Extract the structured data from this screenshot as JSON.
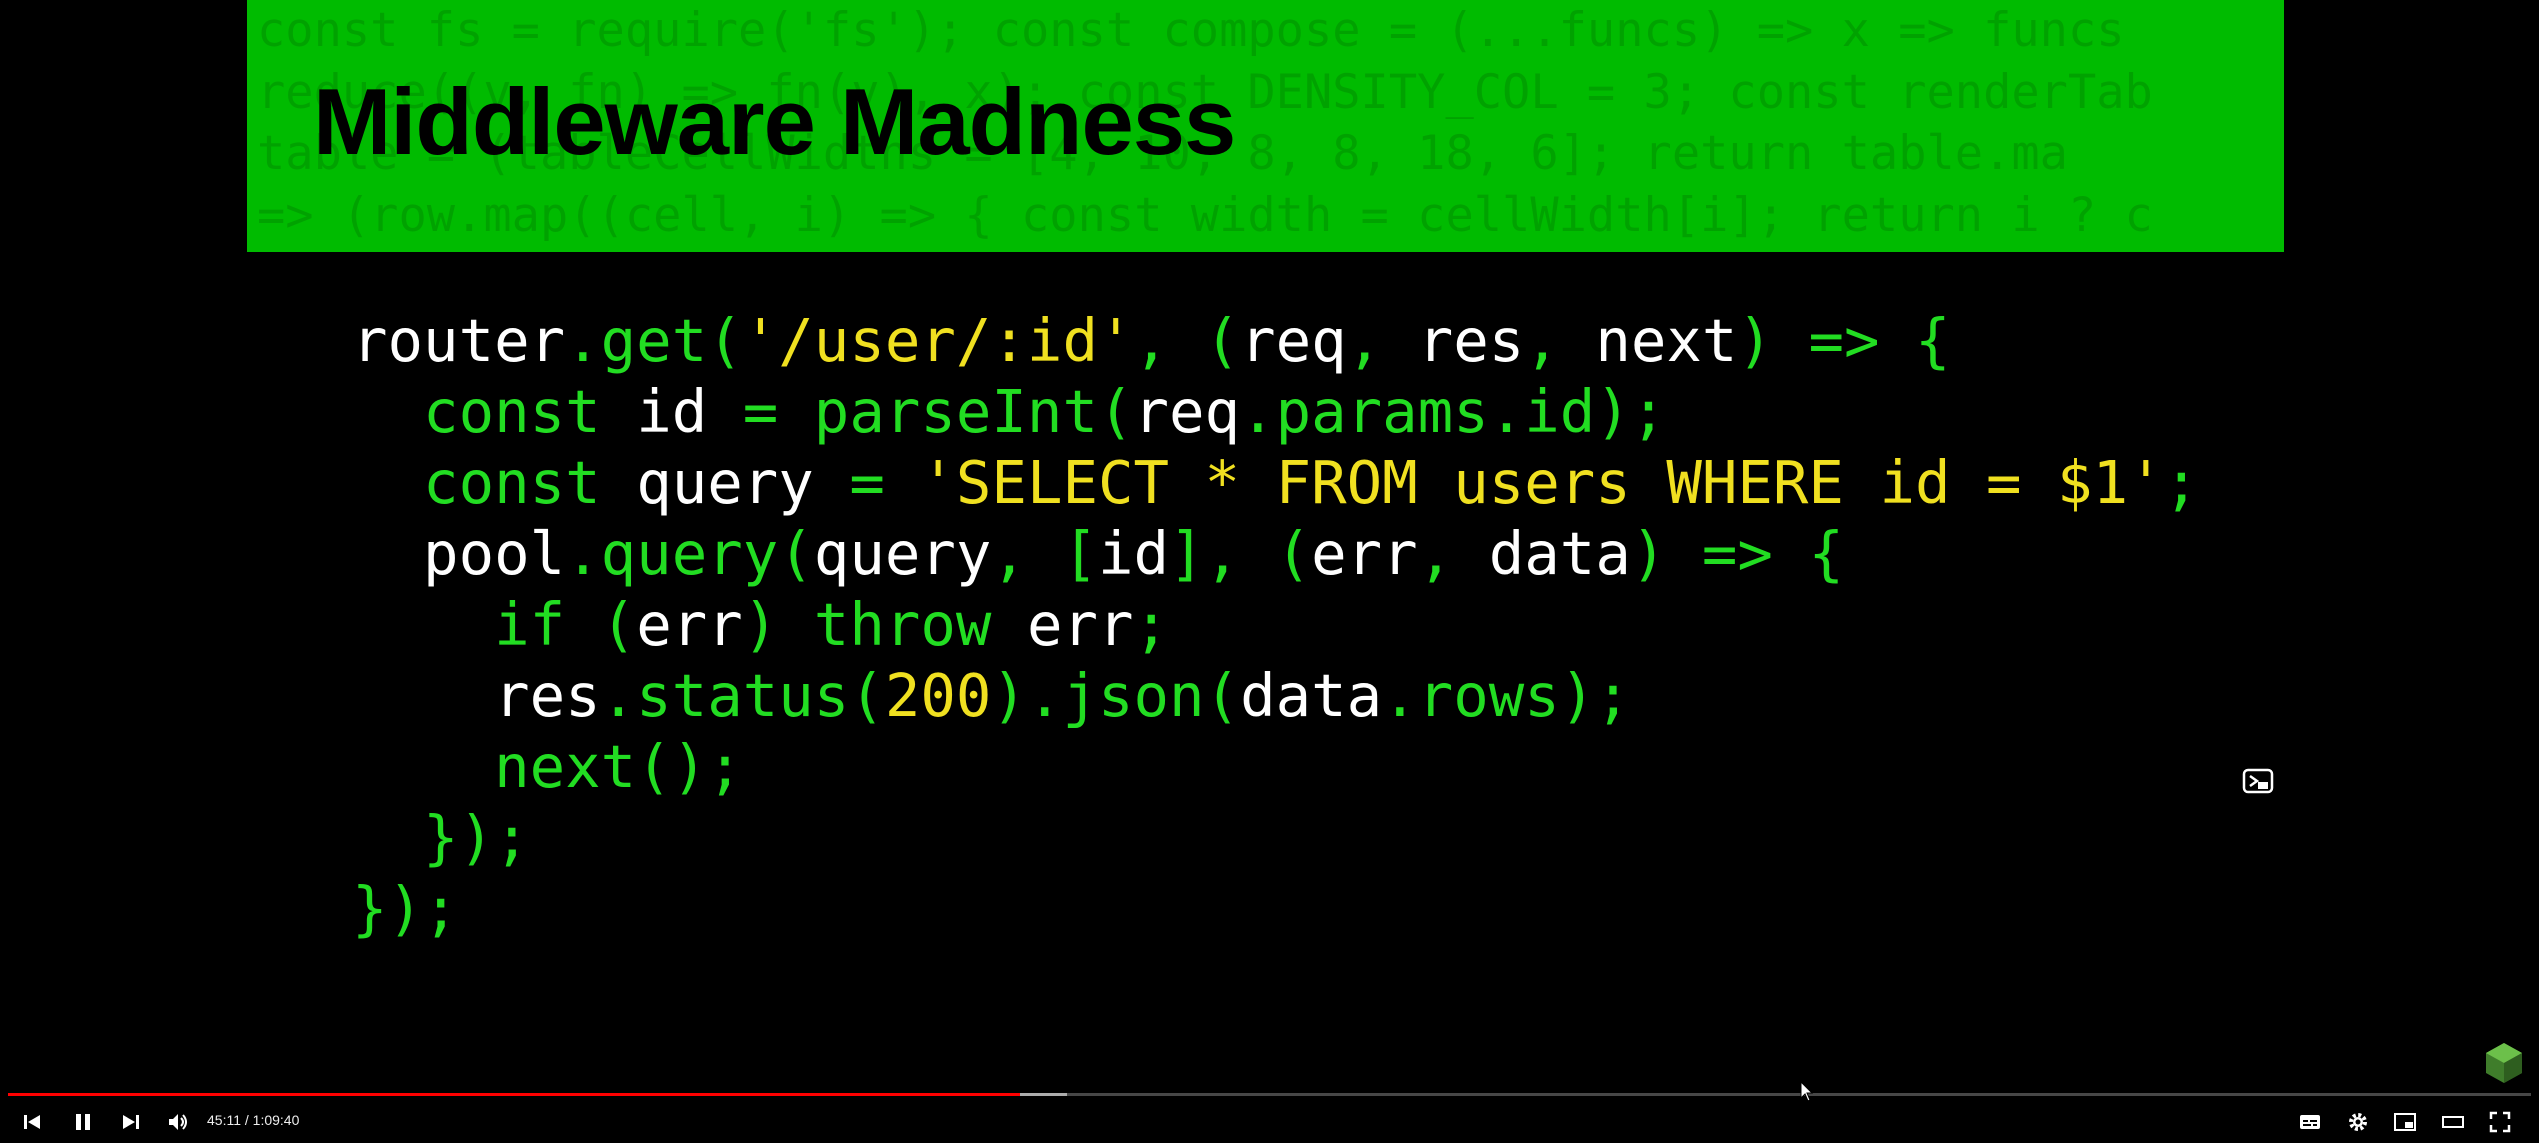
{
  "slide": {
    "title": "Middleware Madness",
    "background_code": [
      "const fs = require('fs'); const compose = (...funcs) => x => funcs",
      "reduce((v, fn) => fn(v), x); const DENSITY_COL = 3; const renderTab",
      "table = (tableCellWidths = [4, 10, 8, 8, 18, 6]; return table.ma",
      "=> (row.map((cell, i) => { const width = cellWidth[i]; return i ? c"
    ],
    "code_lines": [
      [
        [
          "w",
          "router"
        ],
        [
          "g",
          ".get("
        ],
        [
          "y",
          "'/user/:id'"
        ],
        [
          "g",
          ", ("
        ],
        [
          "w",
          "req"
        ],
        [
          "g",
          ", "
        ],
        [
          "w",
          "res"
        ],
        [
          "g",
          ", "
        ],
        [
          "w",
          "next"
        ],
        [
          "g",
          ") => {"
        ]
      ],
      [
        [
          "w",
          "  "
        ],
        [
          "g",
          "const "
        ],
        [
          "w",
          "id "
        ],
        [
          "g",
          "= parseInt("
        ],
        [
          "w",
          "req"
        ],
        [
          "g",
          ".params.id);"
        ]
      ],
      [
        [
          "w",
          "  "
        ],
        [
          "g",
          "const "
        ],
        [
          "w",
          "query "
        ],
        [
          "g",
          "= "
        ],
        [
          "y",
          "'SELECT * FROM users WHERE id = $1'"
        ],
        [
          "g",
          ";"
        ]
      ],
      [
        [
          "w",
          "  pool"
        ],
        [
          "g",
          ".query("
        ],
        [
          "w",
          "query"
        ],
        [
          "g",
          ", ["
        ],
        [
          "w",
          "id"
        ],
        [
          "g",
          "], ("
        ],
        [
          "w",
          "err"
        ],
        [
          "g",
          ", "
        ],
        [
          "w",
          "data"
        ],
        [
          "g",
          ") => {"
        ]
      ],
      [
        [
          "w",
          "    "
        ],
        [
          "g",
          "if ("
        ],
        [
          "w",
          "err"
        ],
        [
          "g",
          ") throw "
        ],
        [
          "w",
          "err"
        ],
        [
          "g",
          ";"
        ]
      ],
      [
        [
          "w",
          "    res"
        ],
        [
          "g",
          ".status("
        ],
        [
          "y",
          "200"
        ],
        [
          "g",
          ")"
        ],
        [
          "g",
          ".json("
        ],
        [
          "w",
          "data"
        ],
        [
          "g",
          ".rows);"
        ]
      ],
      [
        [
          "w",
          "    "
        ],
        [
          "g",
          "next();"
        ]
      ],
      [
        [
          "w",
          "  "
        ],
        [
          "g",
          "});"
        ]
      ],
      [
        [
          "g",
          "});"
        ]
      ]
    ]
  },
  "player": {
    "time_current": "45:11",
    "time_total": "1:09:40",
    "time_display": "45:11 / 1:09:40",
    "progress_played_fraction": 0.4012,
    "progress_buffered_fraction": 0.4196,
    "state": "playing"
  },
  "colors": {
    "banner": "#00bb00",
    "code_default": "#ffffff",
    "code_green": "#22dd22",
    "code_yellow": "#f0e020",
    "progress_played": "#ff0000"
  },
  "icons": {
    "prev": "skip-previous-icon",
    "pause": "pause-icon",
    "next": "skip-next-icon",
    "volume": "volume-icon",
    "subtitles": "subtitles-icon",
    "settings": "gear-icon",
    "miniplayer": "miniplayer-icon",
    "theater": "theater-mode-icon",
    "fullscreen": "fullscreen-icon",
    "pip": "picture-in-picture-icon",
    "logo": "cube-logo-icon"
  }
}
